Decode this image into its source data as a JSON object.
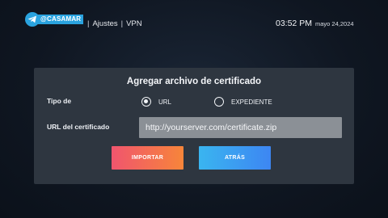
{
  "header": {
    "brand": "@CASAMAR",
    "breadcrumb": [
      "Ajustes",
      "VPN"
    ],
    "time": "03:52 PM",
    "date": "mayo 24,2024"
  },
  "dialog": {
    "title": "Agregar archivo de certificado",
    "type_label": "Tipo de",
    "options": [
      {
        "label": "URL",
        "selected": true
      },
      {
        "label": "EXPEDIENTE",
        "selected": false
      }
    ],
    "url_label": "URL del certificado",
    "url_value": "http://yourserver.com/certificate.zip",
    "buttons": {
      "import": "IMPORTAR",
      "back": "ATRÁS"
    }
  },
  "colors": {
    "brand": "#2aa3df",
    "import_gradient": [
      "#f0556e",
      "#f7853a"
    ],
    "back_gradient": [
      "#3ab5f0",
      "#3d86f2"
    ],
    "dialog_bg": "#2e3640",
    "input_bg": "#8b9096"
  },
  "icons": {
    "brand": "telegram-icon"
  }
}
